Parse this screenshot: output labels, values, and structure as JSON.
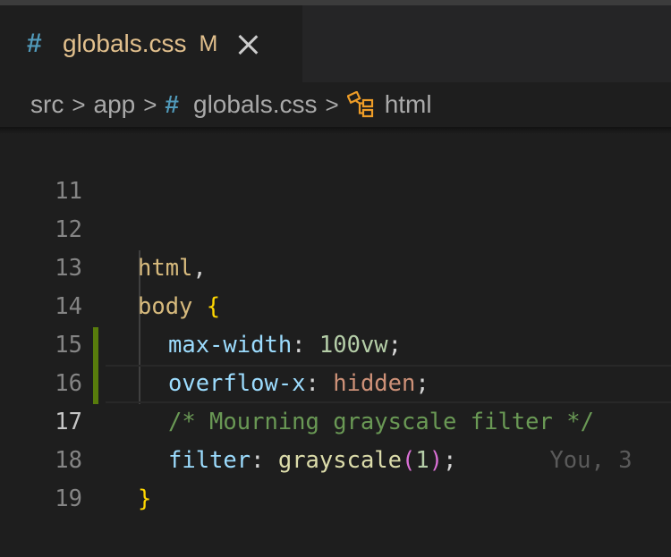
{
  "tab": {
    "icon": "css-hash-icon",
    "hash": "#",
    "filename": "globals.css",
    "status": "M"
  },
  "breadcrumb": {
    "items": [
      "src",
      "app",
      "globals.css",
      "html"
    ],
    "separator": ">",
    "hash": "#"
  },
  "editor": {
    "lines": [
      {
        "num": "11",
        "text": ""
      },
      {
        "num": "12",
        "text": "html,"
      },
      {
        "num": "13",
        "text": "body {"
      },
      {
        "num": "14",
        "prop": "max-width",
        "value": "100vw"
      },
      {
        "num": "15",
        "prop": "overflow-x",
        "value": "hidden"
      },
      {
        "num": "16",
        "comment": "/* Mourning grayscale filter */"
      },
      {
        "num": "17",
        "prop": "filter",
        "fn": "grayscale",
        "arg": "1",
        "blame": "You, 3"
      },
      {
        "num": "18",
        "text": "}"
      },
      {
        "num": "19",
        "text": ""
      }
    ],
    "active_line": "17"
  },
  "colors": {
    "background": "#1e1e1e",
    "modified_gutter": "#587c0c",
    "selector": "#d7ba7d",
    "property": "#9cdcfe",
    "comment": "#6a9955"
  }
}
